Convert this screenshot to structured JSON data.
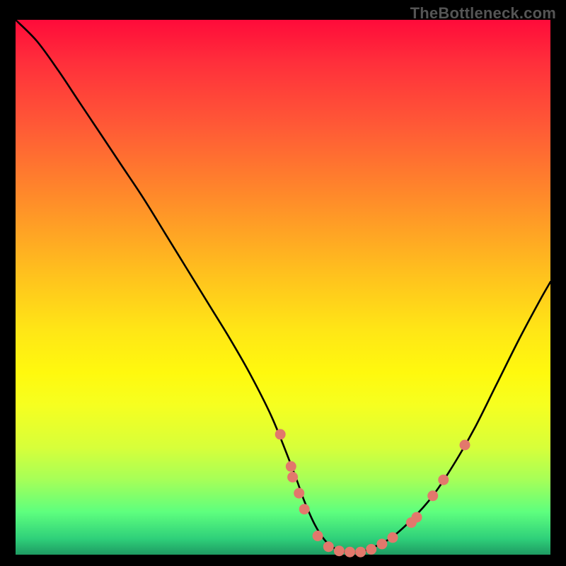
{
  "attribution": "TheBottleneck.com",
  "colors": {
    "dot": "#e2786c",
    "curve": "#000000",
    "gradient_top": "#ff0b3a",
    "gradient_bottom": "#1e9a62"
  },
  "chart_data": {
    "type": "line",
    "title": "",
    "xlabel": "",
    "ylabel": "",
    "xlim": [
      0,
      100
    ],
    "ylim": [
      0,
      100
    ],
    "grid": false,
    "legend": false,
    "annotations": [],
    "series": [
      {
        "name": "bottleneck_curve",
        "x": [
          0,
          4,
          8,
          12,
          16,
          20,
          24,
          28,
          32,
          36,
          40,
          44,
          48,
          52,
          54,
          56,
          58,
          60,
          62,
          64,
          66,
          70,
          74,
          78,
          82,
          86,
          90,
          94,
          98,
          100
        ],
        "y": [
          100,
          96,
          90.5,
          84.5,
          78.5,
          72.5,
          66.5,
          60,
          53.5,
          47,
          40.5,
          33.5,
          25.5,
          15.5,
          10,
          5.5,
          2.5,
          1,
          0.5,
          0.5,
          1,
          3,
          6.5,
          11,
          17,
          24,
          32,
          40,
          47.5,
          51
        ]
      }
    ],
    "points": [
      {
        "x": 49.5,
        "y": 22.5
      },
      {
        "x": 51.5,
        "y": 16.5
      },
      {
        "x": 51.8,
        "y": 14.5
      },
      {
        "x": 53.0,
        "y": 11.5
      },
      {
        "x": 54.0,
        "y": 8.5
      },
      {
        "x": 56.5,
        "y": 3.5
      },
      {
        "x": 58.5,
        "y": 1.5
      },
      {
        "x": 60.5,
        "y": 0.7
      },
      {
        "x": 62.5,
        "y": 0.5
      },
      {
        "x": 64.5,
        "y": 0.5
      },
      {
        "x": 66.5,
        "y": 1.0
      },
      {
        "x": 68.5,
        "y": 2.0
      },
      {
        "x": 70.5,
        "y": 3.2
      },
      {
        "x": 74.0,
        "y": 6.0
      },
      {
        "x": 75.0,
        "y": 7.0
      },
      {
        "x": 78.0,
        "y": 11.0
      },
      {
        "x": 80.0,
        "y": 14.0
      },
      {
        "x": 84.0,
        "y": 20.5
      }
    ]
  }
}
